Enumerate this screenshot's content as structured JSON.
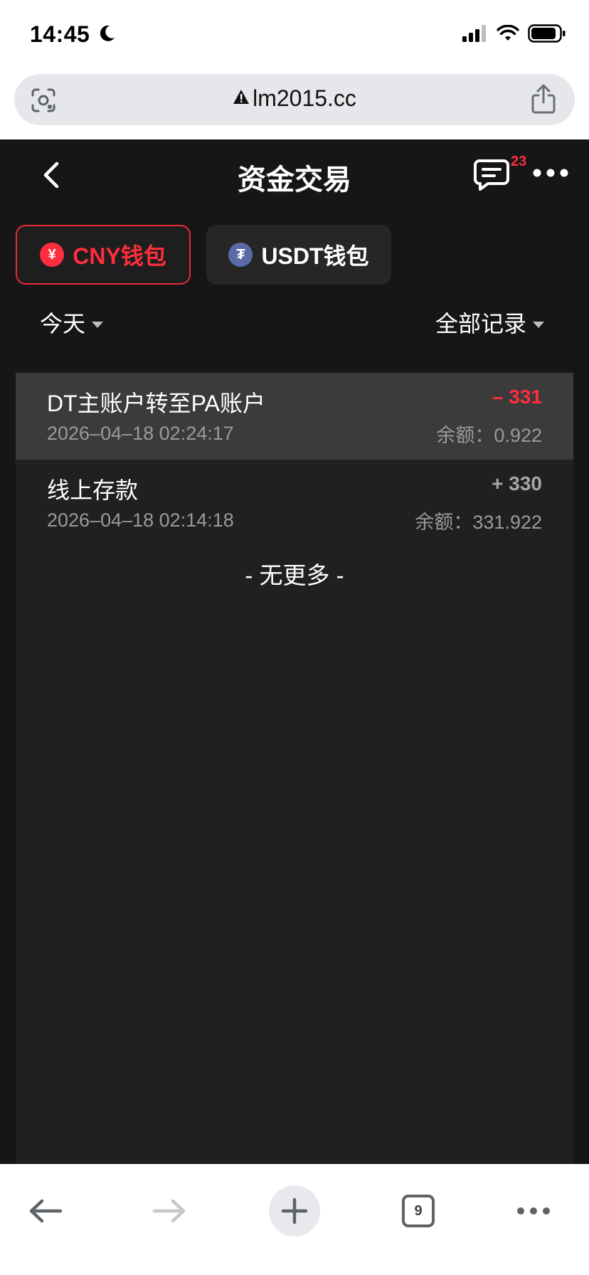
{
  "status_bar": {
    "time": "14:45"
  },
  "browser": {
    "url": "lm2015.cc",
    "tab_count": "9"
  },
  "header": {
    "title": "资金交易",
    "message_badge": "23"
  },
  "wallet_tabs": [
    {
      "label": "CNY钱包",
      "coin_glyph": "¥",
      "active": true
    },
    {
      "label": "USDT钱包",
      "coin_glyph": "₮",
      "active": false
    }
  ],
  "filters": {
    "date_label": "今天",
    "type_label": "全部记录"
  },
  "records": [
    {
      "title": "DT主账户转至PA账户",
      "time": "2026–04–18 02:24:17",
      "amount": "– 331",
      "balance": "余额：0.922"
    },
    {
      "title": "线上存款",
      "time": "2026–04–18 02:14:18",
      "amount": "+ 330",
      "balance": "余额：331.922"
    }
  ],
  "no_more_text": "- 无更多 -",
  "colors": {
    "accent_red": "#ff2d3d",
    "app_bg": "#161616",
    "list_bg": "#202020",
    "highlight_row": "#3b3b3b"
  }
}
